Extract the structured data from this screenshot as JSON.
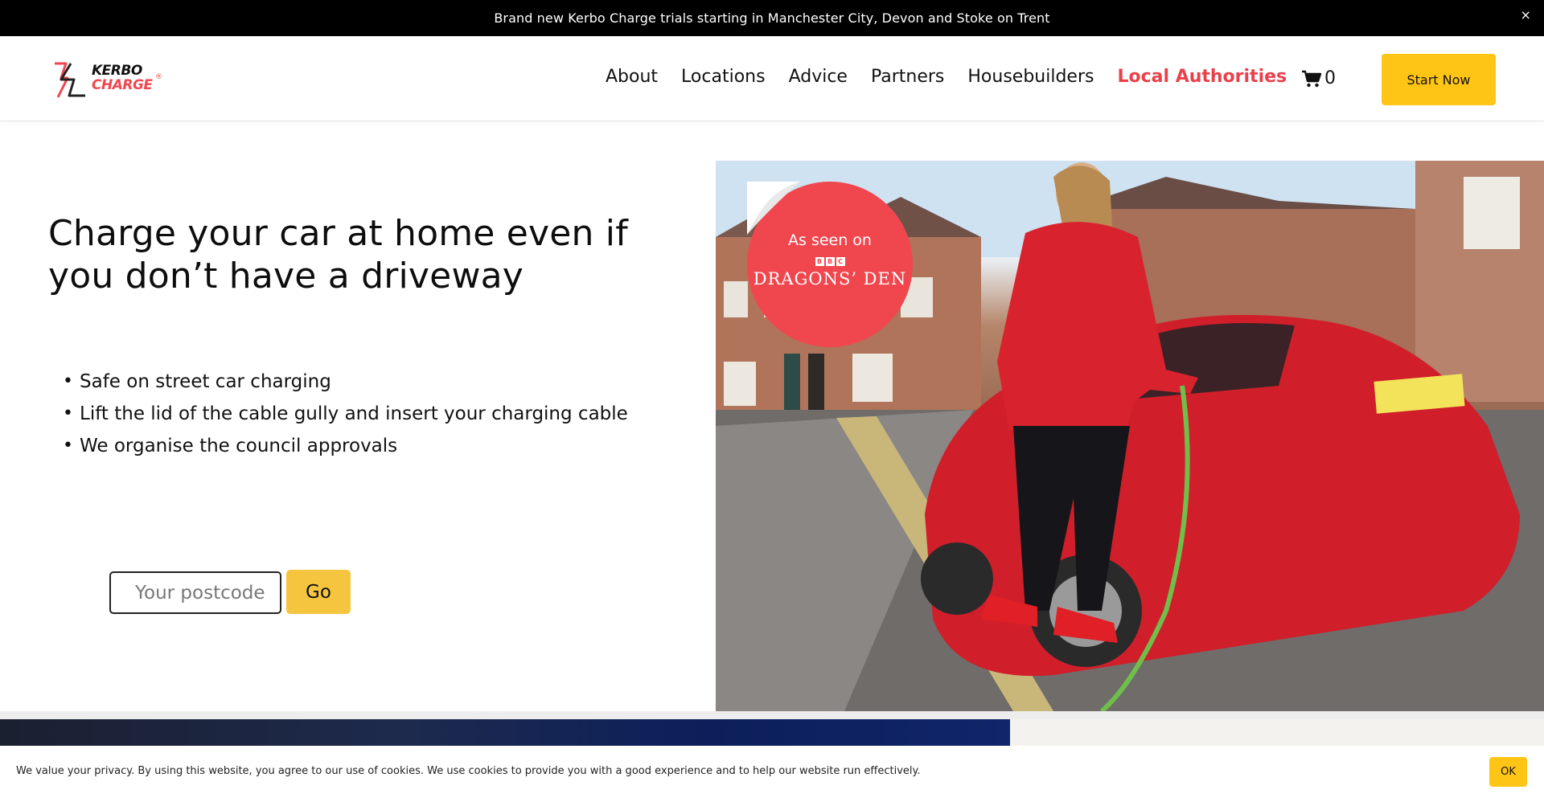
{
  "announcement": {
    "text": "Brand new Kerbo Charge trials starting in Manchester City, Devon and Stoke on Trent",
    "close": "×"
  },
  "header": {
    "logo": {
      "line1": "KERBO",
      "line2": "CHARGE",
      "reg": "®"
    },
    "nav": [
      "About",
      "Locations",
      "Advice",
      "Partners",
      "Housebuilders",
      "Local Authorities"
    ],
    "cart_count": "0",
    "cta": "Start Now"
  },
  "hero": {
    "title": "Charge your car at home even if you don’t have a driveway",
    "bullets": [
      "Safe on street car charging",
      "Lift the lid of the cable gully and insert your charging cable",
      "We organise the council approvals"
    ],
    "postcode_placeholder": "Your postcode",
    "go_label": "Go"
  },
  "badge": {
    "seen": "As seen on",
    "bbc": [
      "B",
      "B",
      "C"
    ],
    "show": "DRAGONS’ DEN"
  },
  "cookie": {
    "text": "We value your privacy.  By using this website, you agree to our use of cookies. We use cookies to provide you with a good experience and to help our website run effectively.",
    "ok": "OK"
  },
  "colors": {
    "brand_red": "#f0474f",
    "brand_yellow": "#ffc516",
    "nav_accent": "#e9414c"
  }
}
